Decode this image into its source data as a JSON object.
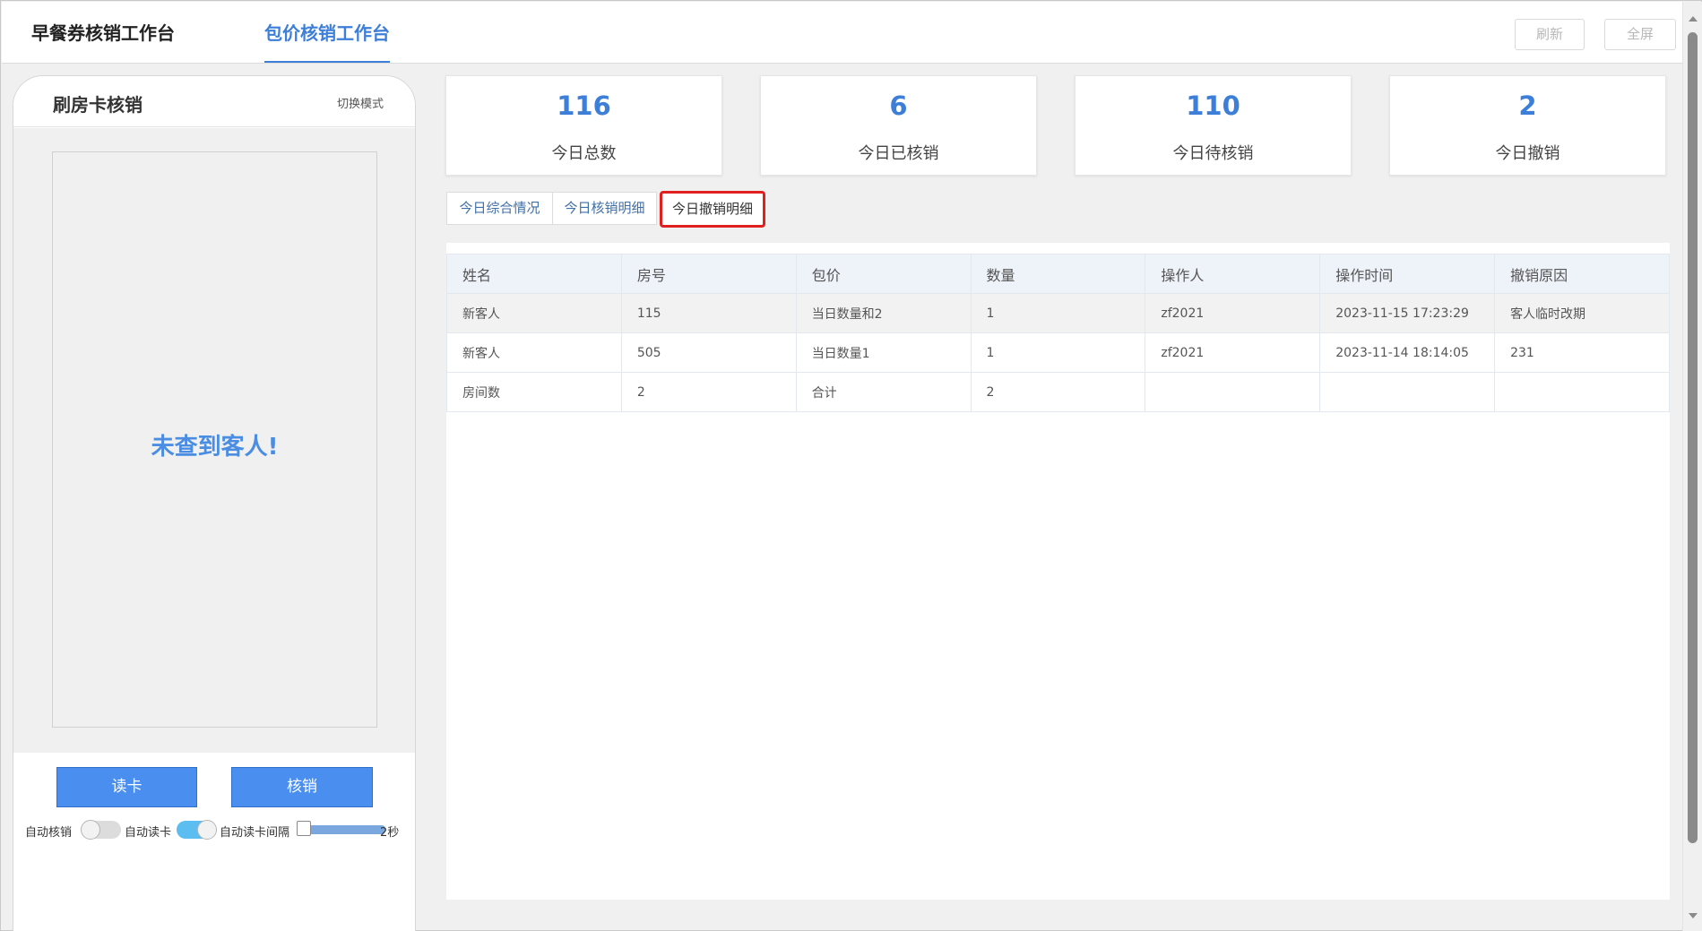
{
  "top_tabs": [
    "早餐券核销工作台",
    "包价核销工作台"
  ],
  "top_buttons": {
    "refresh": "刷新",
    "fullscreen": "全屏"
  },
  "phone": {
    "title": "刷房卡核销",
    "switch_mode": "切换模式",
    "message": "未查到客人!",
    "read_card_button": "读卡",
    "verify_button": "核销",
    "auto_verify_label": "自动核销",
    "auto_read_label": "自动读卡",
    "auto_read_interval_label": "自动读卡间隔",
    "interval_value": "2秒",
    "auto_verify_on": false,
    "auto_read_on": true
  },
  "stats": [
    {
      "value": "116",
      "label": "今日总数"
    },
    {
      "value": "6",
      "label": "今日已核销"
    },
    {
      "value": "110",
      "label": "今日待核销"
    },
    {
      "value": "2",
      "label": "今日撤销"
    }
  ],
  "sub_tabs": [
    "今日综合情况",
    "今日核销明细",
    "今日撤销明细"
  ],
  "table": {
    "headers": [
      "姓名",
      "房号",
      "包价",
      "数量",
      "操作人",
      "操作时间",
      "撤销原因"
    ],
    "rows": [
      [
        "新客人",
        "115",
        "当日数量和2",
        "1",
        "zf2021",
        "2023-11-15 17:23:29",
        "客人临时改期"
      ],
      [
        "新客人",
        "505",
        "当日数量1",
        "1",
        "zf2021",
        "2023-11-14 18:14:05",
        "231"
      ],
      [
        "房间数",
        "2",
        "合计",
        "2",
        "",
        "",
        ""
      ]
    ]
  },
  "colors": {
    "accent": "#3c7ed8",
    "button_blue": "#4a8ff0",
    "highlight_red": "#e0201e"
  }
}
